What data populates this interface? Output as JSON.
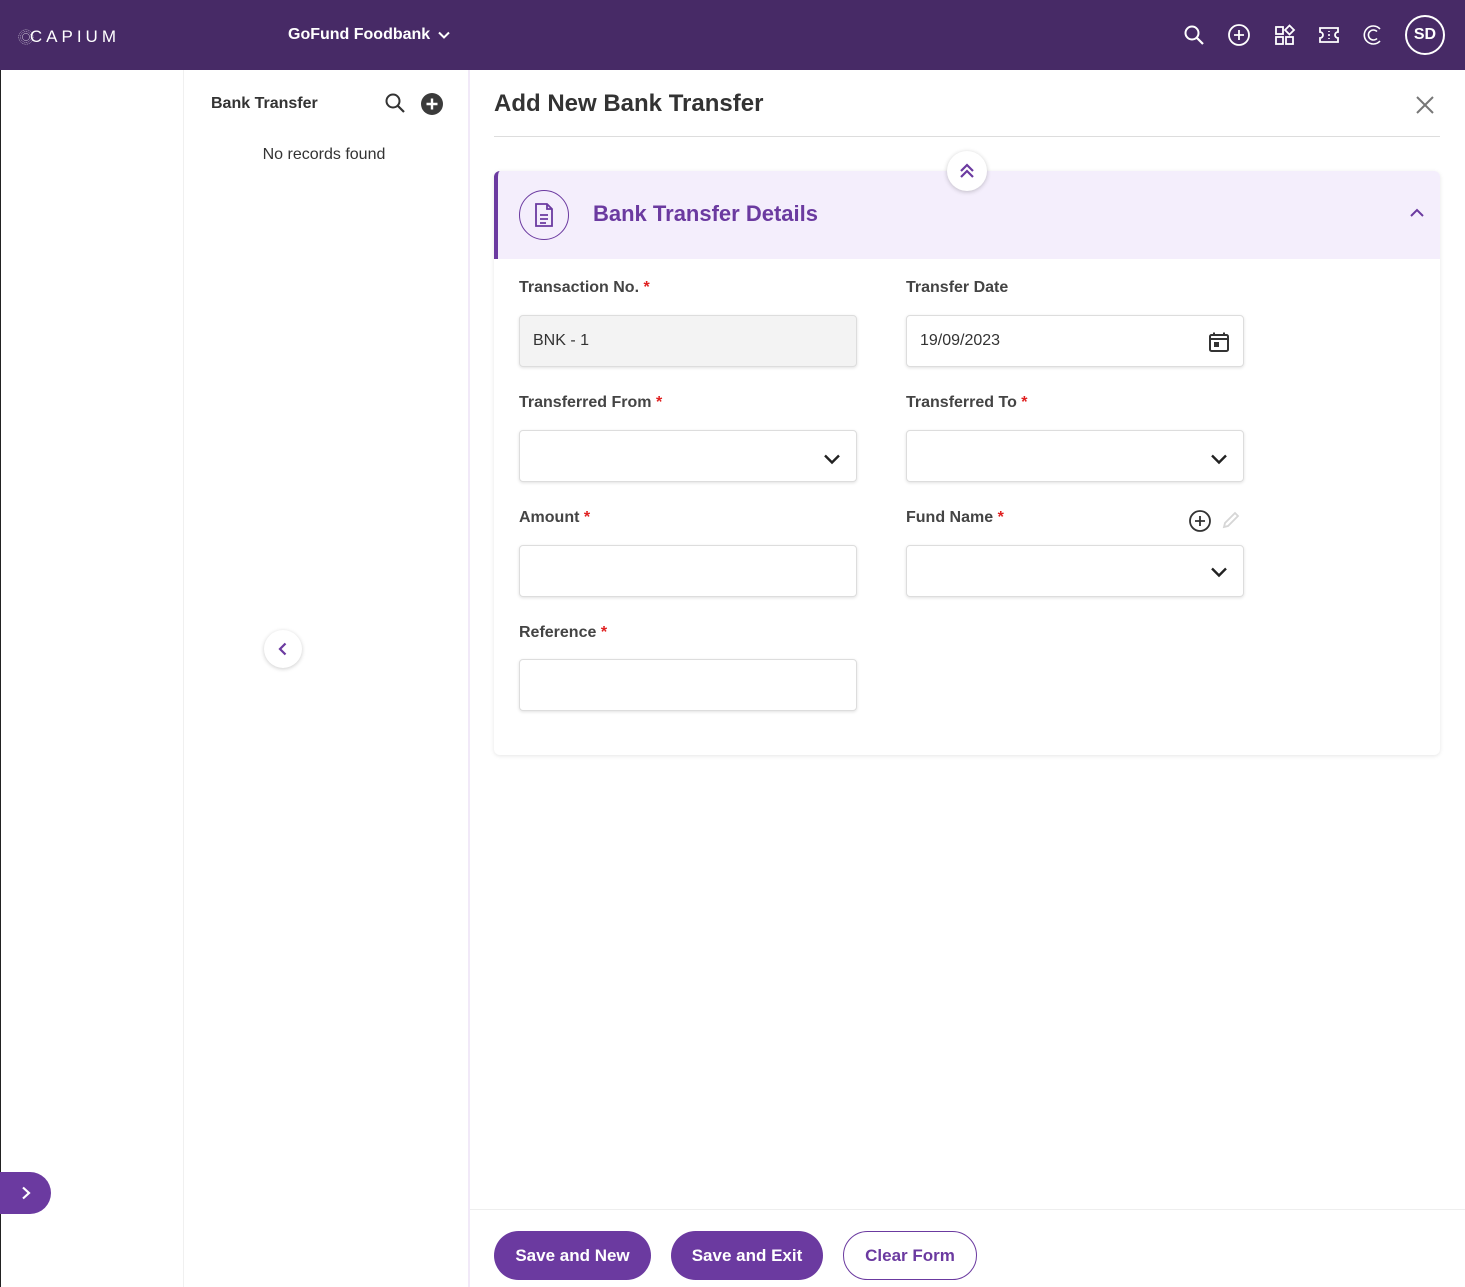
{
  "topbar": {
    "logo_text": "CAPIUM",
    "org_name": "GoFund Foodbank",
    "avatar_initials": "SD",
    "icons": [
      "search-icon",
      "add-circle-icon",
      "apps-grid-icon",
      "ticket-icon",
      "capium-c-icon"
    ]
  },
  "list": {
    "title": "Bank Transfer",
    "empty_text": "No records found"
  },
  "main": {
    "title": "Add New Bank Transfer",
    "section_title": "Bank Transfer Details",
    "fields": {
      "transaction_no": {
        "label": "Transaction No.",
        "value": "BNK - 1",
        "required": "*"
      },
      "transfer_date": {
        "label": "Transfer Date",
        "value": "19/09/2023"
      },
      "transferred_from": {
        "label": "Transferred From",
        "value": "",
        "required": "*"
      },
      "transferred_to": {
        "label": "Transferred To",
        "value": "",
        "required": "*"
      },
      "amount": {
        "label": "Amount",
        "value": "",
        "required": "*"
      },
      "fund_name": {
        "label": "Fund Name",
        "value": "",
        "required": "*"
      },
      "reference": {
        "label": "Reference",
        "value": "",
        "required": "*"
      }
    }
  },
  "footer": {
    "save_new": "Save and New",
    "save_exit": "Save and Exit",
    "clear_form": "Clear Form"
  },
  "colors": {
    "topbar": "#472a66",
    "accent": "#6b3aa0",
    "section_bg": "#f4eefc",
    "required": "#e02020"
  }
}
